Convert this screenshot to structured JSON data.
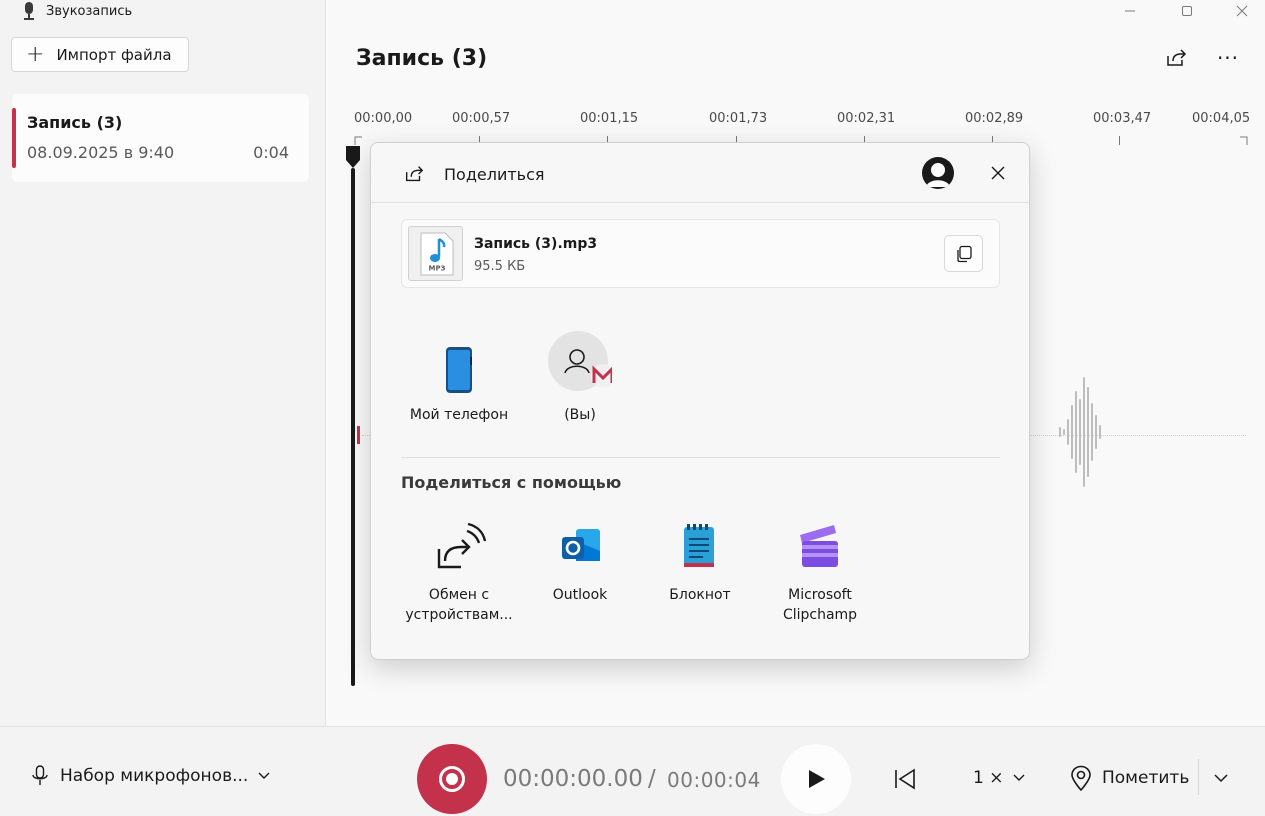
{
  "app": {
    "title": "Звукозапись"
  },
  "sidebar": {
    "import_label": "Импорт файла",
    "recording": {
      "title": "Запись (3)",
      "date": "08.09.2025 в 9:40",
      "duration": "0:04"
    }
  },
  "main": {
    "title": "Запись (3)",
    "timeline": [
      "00:00,00",
      "00:00,57",
      "00:01,15",
      "00:01,73",
      "00:02,31",
      "00:02,89",
      "00:03,47",
      "00:04,05"
    ]
  },
  "share": {
    "title": "Поделиться",
    "file_name": "Запись (3).mp3",
    "file_size": "95.5 КБ",
    "file_thumb_label": "MP3",
    "targets": [
      {
        "label": "Мой телефон",
        "icon": "phone-icon"
      },
      {
        "label": "(Вы)",
        "icon": "contact-icon"
      }
    ],
    "section_label": "Поделиться с помощью",
    "apps": [
      {
        "label": "Обмен с устройствам...",
        "icon": "nearby-share-icon"
      },
      {
        "label": "Outlook",
        "icon": "outlook-icon"
      },
      {
        "label": "Блокнот",
        "icon": "notepad-icon"
      },
      {
        "label": "Microsoft Clipchamp",
        "icon": "clipchamp-icon"
      }
    ]
  },
  "bottom": {
    "mic_label": "Набор микрофонов...",
    "time_current": "00:00:00.00",
    "time_separator": "/",
    "time_total": "00:00:04",
    "speed": "1 ×",
    "mark_label": "Пометить"
  },
  "colors": {
    "accent": "#c4314b",
    "outlook": "#0f6cbd",
    "clipchamp": "#7b4de0"
  }
}
